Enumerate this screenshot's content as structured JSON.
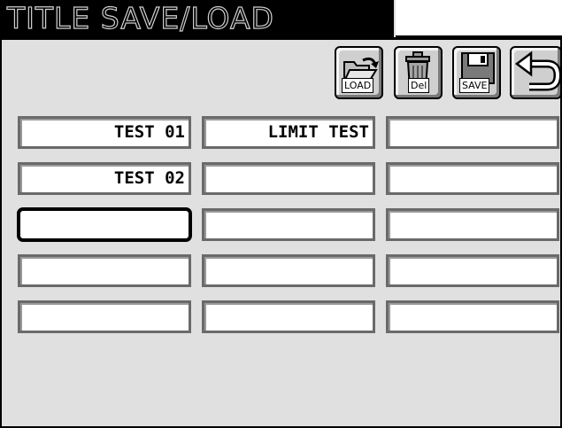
{
  "header": {
    "title": "TITLE SAVE/LOAD"
  },
  "toolbar": {
    "load_label": "LOAD",
    "delete_label": "Del",
    "save_label": "SAVE",
    "back_icon": "return-arrow-icon"
  },
  "slots": [
    [
      "TEST 01",
      "LIMIT TEST",
      ""
    ],
    [
      "TEST 02",
      "",
      ""
    ],
    [
      "",
      "",
      ""
    ],
    [
      "",
      "",
      ""
    ],
    [
      "",
      "",
      ""
    ]
  ],
  "selected_slot": {
    "row": 3,
    "column": 1
  }
}
